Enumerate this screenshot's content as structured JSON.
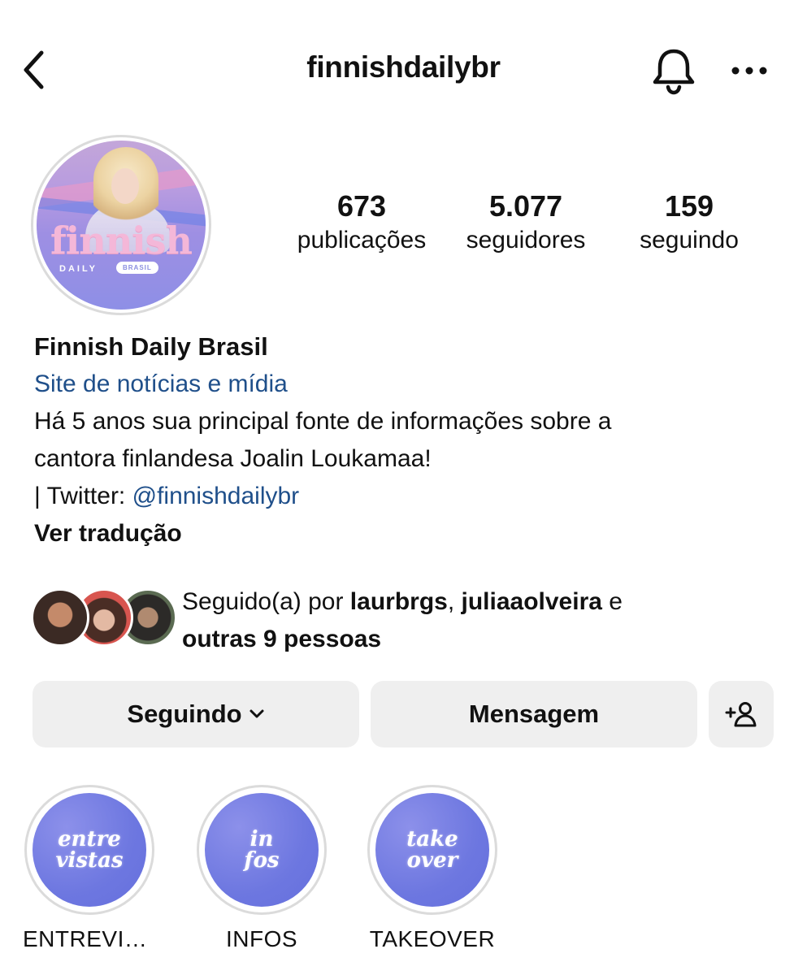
{
  "header": {
    "username": "finnishdailybr",
    "back_icon": "chevron-left-icon",
    "bell_icon": "bell-icon",
    "more_icon": "more-horizontal-icon"
  },
  "avatar": {
    "logo_text": "finnish",
    "logo_sub": "DAILY",
    "logo_badge": "BRASIL"
  },
  "stats": {
    "posts_count": "673",
    "posts_label": "publicações",
    "followers_count": "5.077",
    "followers_label": "seguidores",
    "following_count": "159",
    "following_label": "seguindo"
  },
  "bio": {
    "name": "Finnish Daily Brasil",
    "category": "Site de notícias e mídia",
    "line1": "Há 5 anos sua principal fonte de informações sobre a",
    "line2": "cantora finlandesa Joalin Loukamaa!",
    "twitter_prefix": "| Twitter: ",
    "twitter_handle": "@finnishdailybr",
    "translate": "Ver tradução"
  },
  "followed_by": {
    "prefix": "Seguido(a) por ",
    "user1": "laurbrgs",
    "separator": ", ",
    "user2": "juliaaolveira",
    "conj": " e",
    "others": "outras 9 pessoas"
  },
  "buttons": {
    "following": "Seguindo",
    "message": "Mensagem",
    "add_user_icon": "add-user-icon"
  },
  "highlights": [
    {
      "label": "ENTREVIST...",
      "cover_line1": "entre",
      "cover_line2": "vistas"
    },
    {
      "label": "INFOS",
      "cover_line1": "in",
      "cover_line2": "fos"
    },
    {
      "label": "TAKEOVER",
      "cover_line1": "take",
      "cover_line2": "over"
    }
  ],
  "colors": {
    "link": "#1f4f8a",
    "button_bg": "#efefef",
    "highlight_bg": "#6d77e0"
  }
}
